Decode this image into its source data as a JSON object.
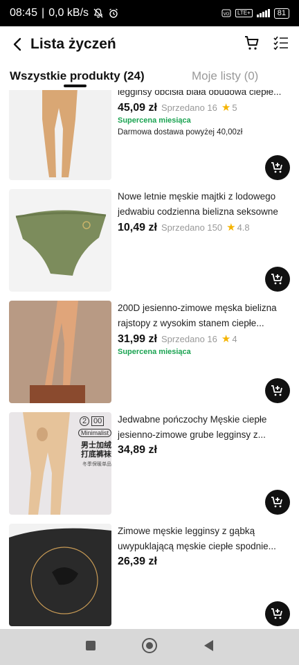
{
  "status_bar": {
    "time": "08:45",
    "speed": "0,0 kB/s",
    "network": "LTE+",
    "battery": "81"
  },
  "header": {
    "title": "Lista życzeń"
  },
  "tabs": [
    {
      "label": "Wszystkie produkty (24)",
      "active": true
    },
    {
      "label": "Moje listy (0)",
      "active": false
    }
  ],
  "products": [
    {
      "title": "legginsy obcisła biała obudowa ciepłe...",
      "price": "45,09 zł",
      "sold": "Sprzedano 16",
      "rating": "5",
      "badge": "Supercena miesiąca",
      "shipping": "Darmowa dostawa powyżej 40,00zł"
    },
    {
      "title": "Nowe letnie męskie majtki z lodowego jedwabiu codzienna bielizna seksowne fi...",
      "price": "10,49 zł",
      "sold": "Sprzedano 150",
      "rating": "4.8"
    },
    {
      "title": "200D jesienno-zimowe męska bielizna rajstopy z wysokim stanem ciepłe...",
      "price": "31,99 zł",
      "sold": "Sprzedano 16",
      "rating": "4",
      "badge": "Supercena miesiąca"
    },
    {
      "title": "Jedwabne pończochy Męskie ciepłe jesienno-zimowe grube legginsy z...",
      "price": "34,89 zł",
      "image_text": {
        "top": "2",
        "top2": "00",
        "brand": "Minimalist",
        "cn1": "男士加绒",
        "cn2": "打底裤袜",
        "cn3": "冬季保暖单品"
      }
    },
    {
      "title": "Zimowe męskie legginsy z gąbką uwypuklającą męskie ciepłe spodnie...",
      "price": "26,39 zł"
    }
  ],
  "colors": {
    "accent": "#111111",
    "green_badge": "#1aa351",
    "star": "#f5b400"
  },
  "icons": [
    "back-icon",
    "cart-icon",
    "list-check-icon",
    "add-to-cart-icon",
    "star-icon",
    "recents-icon",
    "home-icon",
    "back-nav-icon"
  ]
}
